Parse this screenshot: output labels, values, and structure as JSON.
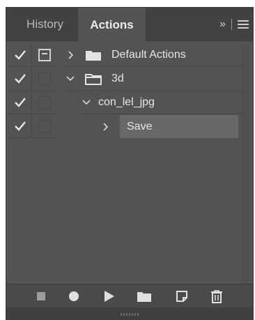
{
  "tabs": {
    "history": "History",
    "actions": "Actions",
    "overflow": "»"
  },
  "actions": [
    {
      "label": "Default Actions",
      "enabled": true,
      "dialog": true,
      "expanded": false,
      "type": "set",
      "icon": "folder-icon"
    },
    {
      "label": "3d",
      "enabled": true,
      "dialog": false,
      "expanded": true,
      "type": "set",
      "icon": "folder-open-icon"
    },
    {
      "label": "con_lel_jpg",
      "enabled": true,
      "dialog": false,
      "expanded": true,
      "type": "action"
    },
    {
      "label": "Save",
      "enabled": true,
      "dialog": false,
      "expanded": false,
      "type": "command",
      "selected": true
    }
  ],
  "toolbar": {
    "icons": [
      "stop-icon",
      "record-icon",
      "play-icon",
      "new-set-icon",
      "new-action-icon",
      "trash-icon"
    ]
  },
  "colors": {
    "panel": "#535353",
    "tabbar": "#424242",
    "selected_row": "#686868",
    "text": "#e6e6e6"
  }
}
